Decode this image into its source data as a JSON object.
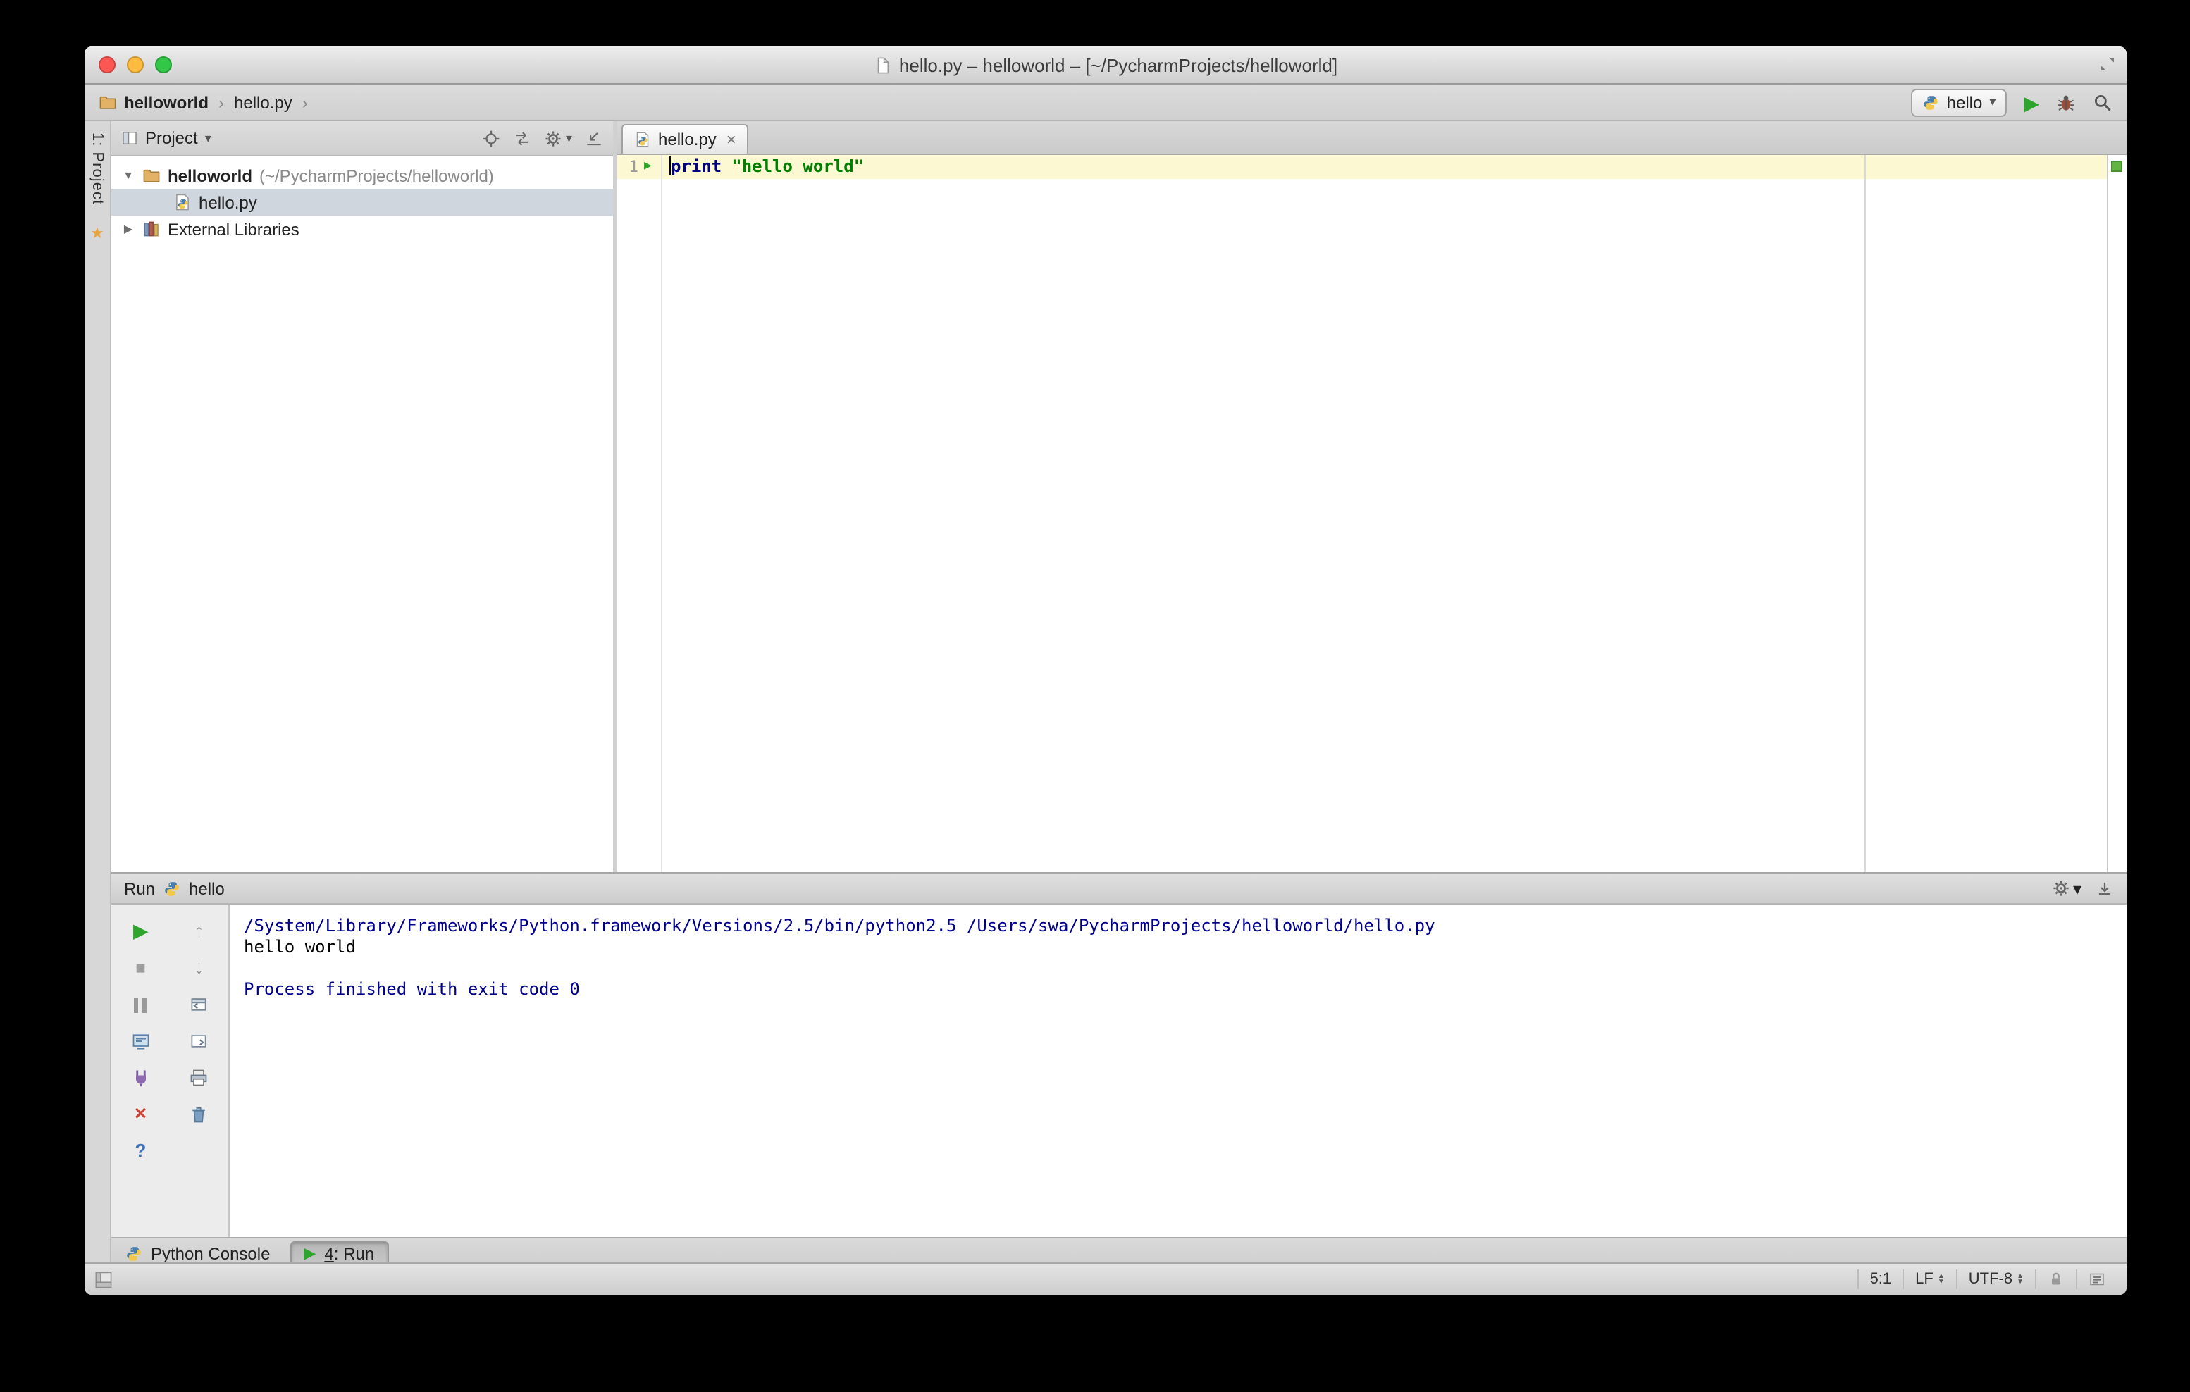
{
  "titlebar": {
    "title": "hello.py – helloworld – [~/PycharmProjects/helloworld]"
  },
  "navbar": {
    "crumb_project": "helloworld",
    "crumb_file": "hello.py",
    "run_config": "hello"
  },
  "icons": {
    "chevron": "›",
    "dropdown": "▾",
    "expanded": "▼",
    "collapsed": "▶",
    "play": "▶",
    "stop": "■",
    "up": "↑",
    "down": "↓",
    "close": "×",
    "help": "?",
    "star": "★",
    "spin_up": "▲",
    "spin_down": "▼",
    "tab_close": "×"
  },
  "tool_strip": {
    "project_button": "1: Project"
  },
  "project_panel": {
    "header": "Project",
    "root_name": "helloworld",
    "root_path": "(~/PycharmProjects/helloworld)",
    "file_name": "hello.py",
    "external_libs": "External Libraries"
  },
  "editor": {
    "tab": "hello.py",
    "line_number": "1",
    "keyword": "print",
    "string": "\"hello world\""
  },
  "run_panel": {
    "title": "Run",
    "config": "hello",
    "lines": [
      "/System/Library/Frameworks/Python.framework/Versions/2.5/bin/python2.5 /Users/swa/PycharmProjects/helloworld/hello.py",
      "hello world",
      "",
      "Process finished with exit code 0"
    ]
  },
  "toolwindow_bar": {
    "python_console": "Python Console",
    "run_number": "4",
    "run_label": ": Run"
  },
  "status_bar": {
    "caret": "5:1",
    "line_sep": "LF",
    "encoding": "UTF-8"
  }
}
